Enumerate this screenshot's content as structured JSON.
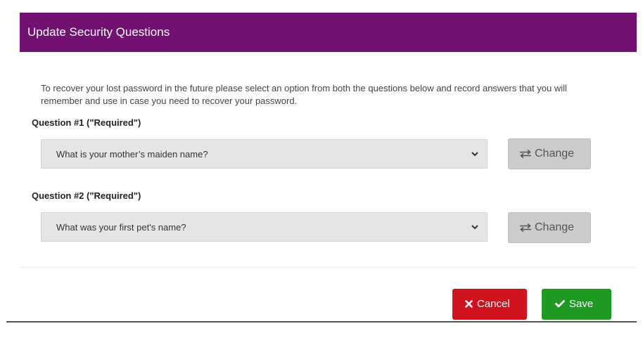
{
  "dialog": {
    "title": "Update Security Questions",
    "intro_text": "To recover your lost password in the future please select an option from both the questions below and record answers that you will remember and use in case you need to recover your password."
  },
  "questions": [
    {
      "label": "Question #1 (\"Required\")",
      "selected": "What is your mother’s maiden name?",
      "change_label": "Change"
    },
    {
      "label": "Question #2 (\"Required\")",
      "selected": "What was your first pet's name?",
      "change_label": "Change"
    }
  ],
  "footer": {
    "cancel_label": "Cancel",
    "save_label": "Save"
  },
  "icons": {
    "change": "swap-arrows-icon",
    "select": "chevron-down-icon",
    "cancel": "close-icon",
    "save": "check-icon"
  },
  "colors": {
    "header_bg": "#731173",
    "cancel_bg": "#d0121e",
    "save_bg": "#1e9a23",
    "change_bg": "#cccccc",
    "select_bg": "#e5e5e5"
  }
}
